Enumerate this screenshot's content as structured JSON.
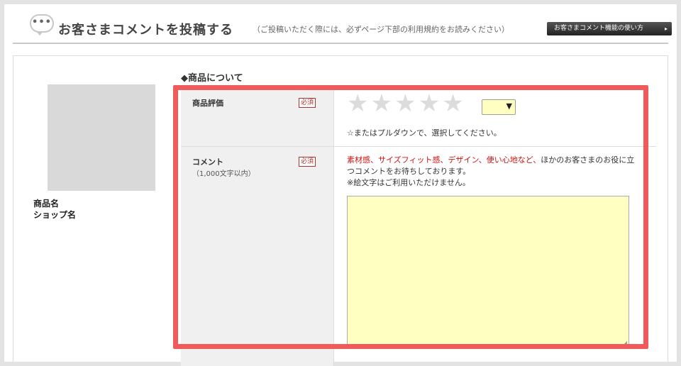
{
  "header": {
    "icon_dots": "•••",
    "title": "お客さまコメントを投稿する",
    "subtitle": "（ご投稿いただく際には、必ずページ下部の利用規約をお読みください）",
    "guide_button": "お客さまコメント機能の使い方",
    "guide_arrow": "▸"
  },
  "product": {
    "name_label": "商品名",
    "shop_label": "ショップ名"
  },
  "section": {
    "title": "◆商品について"
  },
  "form": {
    "rating": {
      "label": "商品評価",
      "required": "必須",
      "stars": [
        "★",
        "★",
        "★",
        "★",
        "★"
      ],
      "select_value": "",
      "hint": "☆またはプルダウンで、選択してください。"
    },
    "comment": {
      "label": "コメント",
      "note": "（1,000文字以内）",
      "required": "必須",
      "hint_highlight": "素材感、サイズフィット感、デザイン、使い心地など、",
      "hint_rest": "ほかのお客さまのお役に立つコメントをお待ちしております。",
      "hint_note": "※絵文字はご利用いただけません。",
      "value": ""
    }
  },
  "colors": {
    "highlight_border": "#f05a5a",
    "input_bg": "#ffffc2",
    "accent_red": "#cc1111"
  }
}
